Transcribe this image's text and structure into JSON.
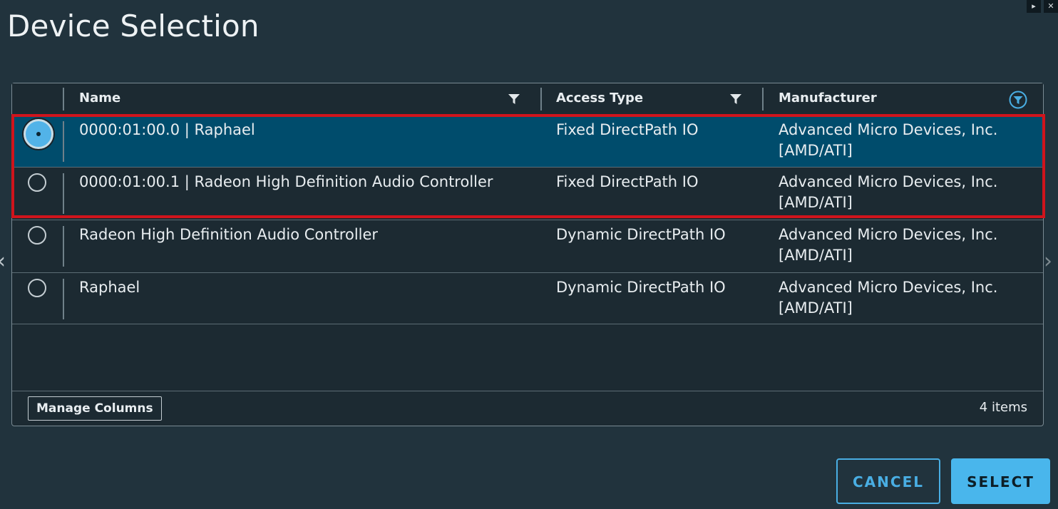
{
  "dialog": {
    "title": "Device Selection"
  },
  "corner_buttons": [
    {
      "icon": "play-icon",
      "glyph": "▸"
    },
    {
      "icon": "close-icon",
      "glyph": "✕"
    }
  ],
  "nav": {
    "prev_glyph": "‹",
    "next_glyph": "›"
  },
  "grid": {
    "columns": [
      {
        "label": "Name",
        "filter": true
      },
      {
        "label": "Access Type",
        "filter": true
      },
      {
        "label": "Manufacturer",
        "filter": "active"
      }
    ],
    "rows": [
      {
        "selected": true,
        "name": "0000:01:00.0 | Raphael",
        "access_type": "Fixed DirectPath IO",
        "manufacturer": "Advanced Micro Devices, Inc. [AMD/ATI]"
      },
      {
        "selected": false,
        "name": "0000:01:00.1 | Radeon High Definition Audio Controller",
        "access_type": "Fixed DirectPath IO",
        "manufacturer": "Advanced Micro Devices, Inc. [AMD/ATI]"
      },
      {
        "selected": false,
        "name": "Radeon High Definition Audio Controller",
        "access_type": "Dynamic DirectPath IO",
        "manufacturer": "Advanced Micro Devices, Inc. [AMD/ATI]"
      },
      {
        "selected": false,
        "name": "Raphael",
        "access_type": "Dynamic DirectPath IO",
        "manufacturer": "Advanced Micro Devices, Inc. [AMD/ATI]"
      }
    ],
    "footer": {
      "manage_columns_label": "Manage Columns",
      "item_count": "4 items"
    }
  },
  "actions": {
    "cancel_label": "CANCEL",
    "select_label": "SELECT"
  },
  "colors": {
    "background": "#21333d",
    "selected_row": "#004c6c",
    "accent": "#49b6ec",
    "highlight_border": "#d0141c"
  }
}
